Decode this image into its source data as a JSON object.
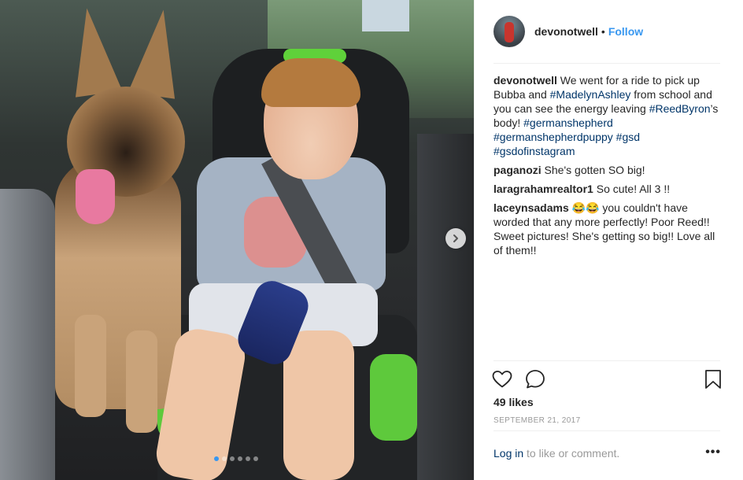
{
  "post": {
    "username": "devonotwell",
    "follow_label": "Follow",
    "separator": "•",
    "caption": {
      "username": "devonotwell",
      "text_1": " We went for a ride to pick up Bubba and ",
      "tag_1": "#MadelynAshley",
      "text_2": " from school and you can see the energy leaving ",
      "tag_2": "#ReedByron",
      "text_3": "’s body! ",
      "tag_3": "#germanshepherd",
      "text_4": " ",
      "tag_4": "#germanshepherdpuppy",
      "text_5": " ",
      "tag_5": "#gsd",
      "text_6": " ",
      "tag_6": "#gsdofinstagram"
    },
    "comments": [
      {
        "username": "paganozi",
        "text": " She's gotten SO big!"
      },
      {
        "username": "laragrahamrealtor1",
        "text": " So cute! All 3 !!"
      },
      {
        "username": "laceynsadams",
        "text": " 😂😂 you couldn't have worded that any more perfectly! Poor Reed!! Sweet pictures! She's getting so big!! Love all of them!!"
      }
    ],
    "likes": "49 likes",
    "date": "SEPTEMBER 21, 2017",
    "login_link": "Log in",
    "login_suffix": " to like or comment.",
    "more_label": "•••"
  },
  "icons": {
    "like": "heart-icon",
    "comment": "comment-bubble-icon",
    "save": "bookmark-icon",
    "next": "chevron-right-icon",
    "more": "more-options-icon"
  },
  "carousel": {
    "slide_count": 6,
    "active_index": 0
  },
  "colors": {
    "link_blue": "#3897f0",
    "hashtag": "#003569",
    "muted": "#999999",
    "text": "#262626"
  }
}
